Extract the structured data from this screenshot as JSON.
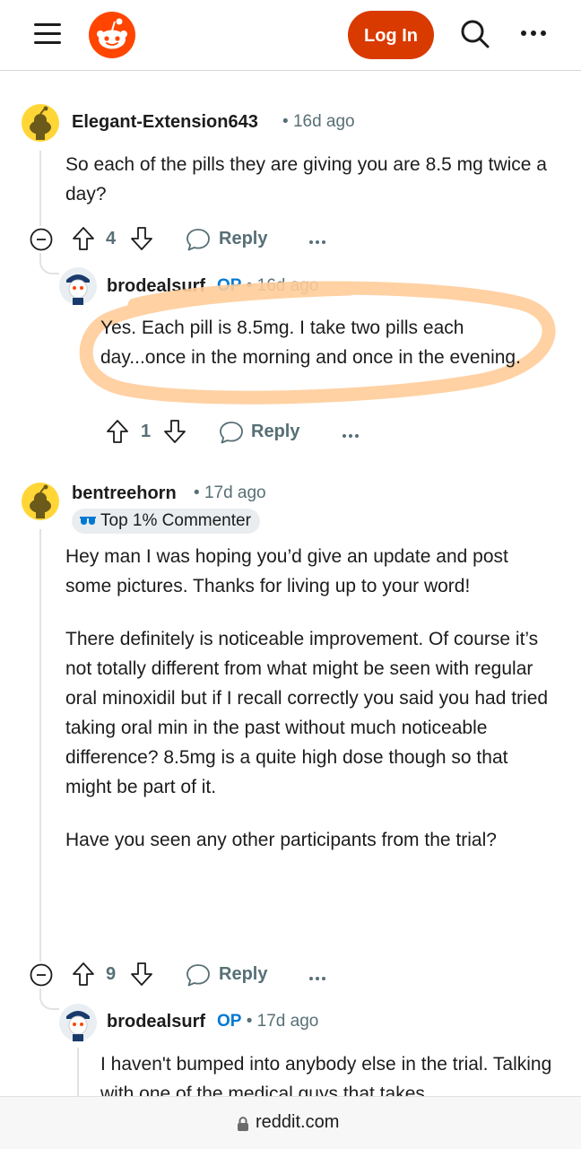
{
  "header": {
    "login_label": "Log In"
  },
  "comments": [
    {
      "username": "Elegant-Extension643",
      "time": "16d ago",
      "body": [
        "So each of the pills they are giving you are 8.5 mg twice a day?"
      ],
      "votes": "4",
      "reply_label": "Reply"
    },
    {
      "username": "brodealsurf",
      "op": "OP",
      "time": "16d ago",
      "body": [
        "Yes. Each pill is 8.5mg. I take two pills each day...once in the morning and once in the evening."
      ],
      "votes": "1",
      "reply_label": "Reply"
    },
    {
      "username": "bentreehorn",
      "time": "17d ago",
      "badge": "Top 1% Commenter",
      "body": [
        "Hey man I was hoping you’d give an update and post some pictures. Thanks for living up to your word!",
        "There definitely is noticeable improvement. Of course it’s not totally different from what might be seen with regular oral minoxidil but if I recall correctly you said you had tried taking oral min in the past without much noticeable difference? 8.5mg is a quite high dose though so that might be part of it.",
        "Have you seen any other participants from the trial?"
      ],
      "votes": "9",
      "reply_label": "Reply"
    },
    {
      "username": "brodealsurf",
      "op": "OP",
      "time": "17d ago",
      "body": [
        "I haven't bumped into anybody else in the trial. Talking with one of the medical guys that takes"
      ]
    }
  ],
  "footer": {
    "domain": "reddit.com"
  },
  "colors": {
    "brand": "#ff4500",
    "login": "#d93a00",
    "op": "#0079d3",
    "highlight": "#ffcc99"
  }
}
